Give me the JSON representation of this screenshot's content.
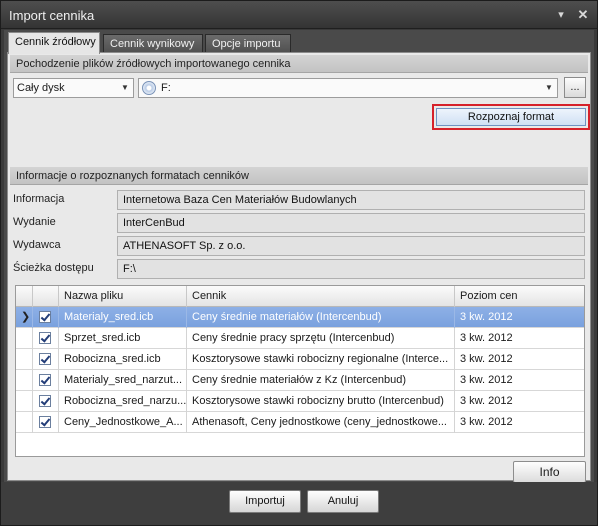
{
  "window": {
    "title": "Import cennika"
  },
  "tabs": [
    {
      "label": "Cennik źródłowy",
      "active": true
    },
    {
      "label": "Cennik wynikowy",
      "active": false
    },
    {
      "label": "Opcje importu",
      "active": false
    }
  ],
  "source": {
    "group_title": "Pochodzenie plików źródłowych importowanego cennika",
    "drive_selected": "Cały dysk",
    "path_value": "F:",
    "browse_label": "...",
    "detect_button": "Rozpoznaj format"
  },
  "info": {
    "group_title": "Informacje o rozpoznanych formatach cenników",
    "fields": [
      {
        "label": "Informacja",
        "value": "Internetowa Baza Cen Materiałów Budowlanych"
      },
      {
        "label": "Wydanie",
        "value": "InterCenBud"
      },
      {
        "label": "Wydawca",
        "value": "ATHENASOFT Sp. z o.o."
      },
      {
        "label": "Ścieżka dostępu",
        "value": "F:\\"
      }
    ]
  },
  "grid": {
    "columns": [
      "Nazwa pliku",
      "Cennik",
      "Poziom cen"
    ],
    "rows": [
      {
        "file": "Materialy_sred.icb",
        "cennik": "Ceny średnie materiałów (Intercenbud)",
        "poziom": "3 kw. 2012",
        "checked": true,
        "selected": true
      },
      {
        "file": "Sprzet_sred.icb",
        "cennik": "Ceny średnie pracy sprzętu (Intercenbud)",
        "poziom": "3 kw. 2012",
        "checked": true,
        "selected": false
      },
      {
        "file": "Robocizna_sred.icb",
        "cennik": "Kosztorysowe stawki robocizny regionalne (Interce...",
        "poziom": "3 kw. 2012",
        "checked": true,
        "selected": false
      },
      {
        "file": "Materialy_sred_narzut...",
        "cennik": "Ceny średnie materiałów z Kz (Intercenbud)",
        "poziom": "3 kw. 2012",
        "checked": true,
        "selected": false
      },
      {
        "file": "Robocizna_sred_narzu...",
        "cennik": "Kosztorysowe stawki robocizny brutto (Intercenbud)",
        "poziom": "3 kw. 2012",
        "checked": true,
        "selected": false
      },
      {
        "file": "Ceny_Jednostkowe_A...",
        "cennik": "Athenasoft, Ceny jednostkowe (ceny_jednostkowe...",
        "poziom": "3 kw. 2012",
        "checked": true,
        "selected": false
      }
    ]
  },
  "buttons": {
    "info": "Info",
    "import": "Importuj",
    "cancel": "Anuluj"
  },
  "colors": {
    "highlight_border": "#d6212a",
    "row_selected": "#7aa1de",
    "dark_chrome": "#3a3a3a"
  }
}
